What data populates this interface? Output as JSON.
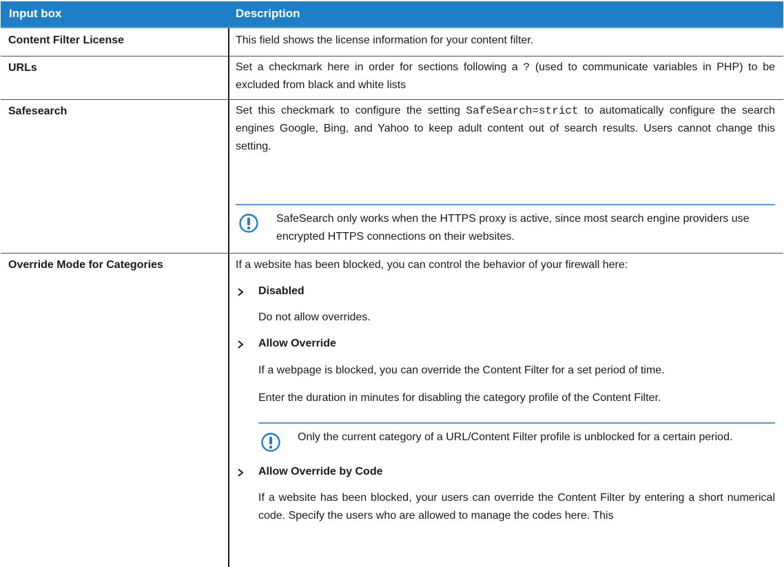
{
  "header": {
    "col1": "Input box",
    "col2": "Description"
  },
  "rows": {
    "license": {
      "label": "Content Filter License",
      "desc": "This field shows the license information for your content filter."
    },
    "urls": {
      "label": "URLs",
      "desc_a": "Set a checkmark here in order for sections following a ",
      "code": "?",
      "desc_b": " (used to communicate variables in PHP) to be excluded from black and white lists"
    },
    "safesearch": {
      "label": "Safesearch",
      "desc_a": "Set this checkmark to configure the setting ",
      "code": "SafeSearch=strict",
      "desc_b": " to automatically configure the search engines Google, Bing, and Yahoo to keep adult content out of search results. Users cannot change this setting.",
      "note": "SafeSearch only works when the HTTPS proxy is active, since most search engine providers use encrypted HTTPS connections on their websites."
    },
    "override": {
      "label": "Override Mode for Categories",
      "intro": "If a website has been blocked, you can control the behavior of your firewall here:",
      "options": [
        {
          "title": "Disabled",
          "text": "Do not allow overrides."
        },
        {
          "title": "Allow Override",
          "text": "If a webpage is blocked, you can override the Content Filter for a set period of time.",
          "text2": "Enter the duration in minutes for disabling the category profile of the Content Filter.",
          "note": "Only the current category of a URL/Content Filter profile is unblocked for a certain period."
        },
        {
          "title": "Allow Override by Code",
          "text": "If a website has been blocked, your users can override the Content Filter by entering a short numerical code. Specify the users who are allowed to manage the codes here. This"
        }
      ]
    }
  },
  "icons": {
    "note": "info-exclamation-icon",
    "bullet": "chevron-right-icon"
  },
  "colors": {
    "header_bg": "#1f7fc6",
    "accent": "#4aa3e0",
    "icon": "#1f7fc6"
  }
}
